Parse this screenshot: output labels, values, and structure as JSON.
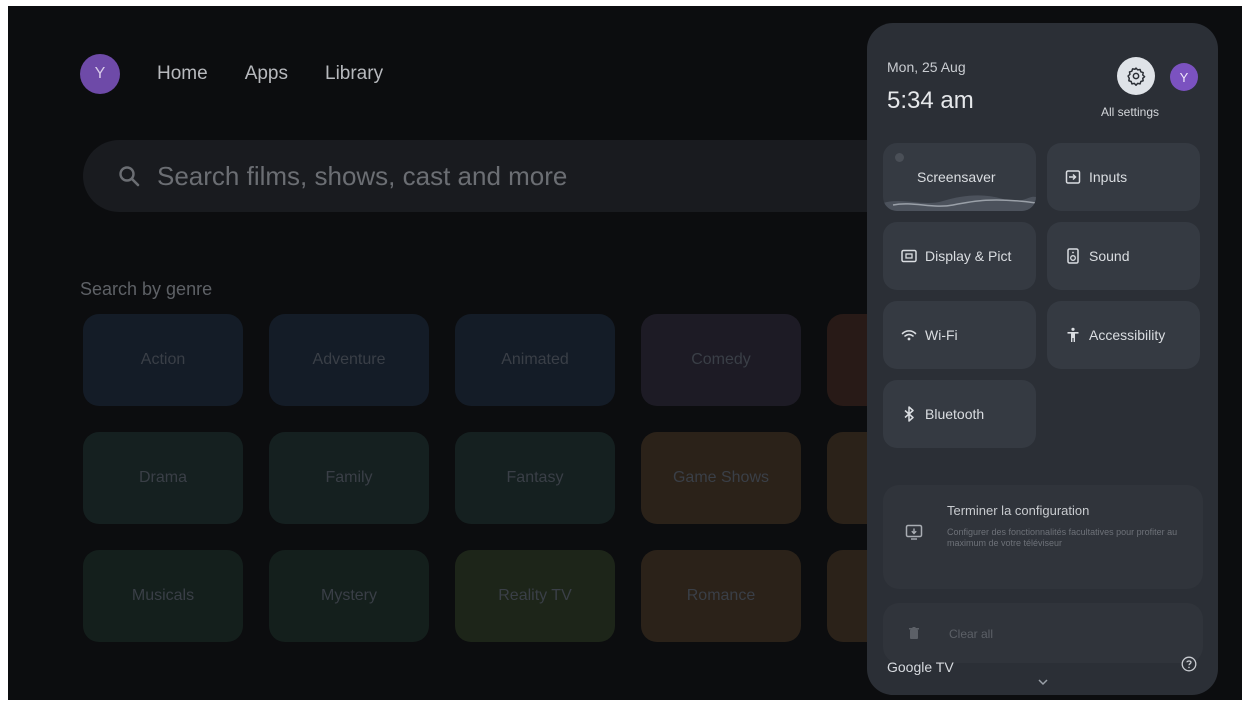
{
  "nav": {
    "avatar_letter": "Y",
    "items": [
      "Home",
      "Apps",
      "Library"
    ]
  },
  "search": {
    "placeholder": "Search films, shows, cast and more"
  },
  "genre": {
    "title": "Search by genre",
    "tiles": [
      {
        "label": "Action",
        "color": "#141c27"
      },
      {
        "label": "Adventure",
        "color": "#141c27"
      },
      {
        "label": "Animated",
        "color": "#141c27"
      },
      {
        "label": "Comedy",
        "color": "#1d1b25"
      },
      {
        "label": "",
        "color": "#281a17"
      },
      {
        "label": "Drama",
        "color": "#152020"
      },
      {
        "label": "Family",
        "color": "#152020"
      },
      {
        "label": "Fantasy",
        "color": "#152020"
      },
      {
        "label": "Game Shows",
        "color": "#2b2219"
      },
      {
        "label": "",
        "color": "#2b2219"
      },
      {
        "label": "Musicals",
        "color": "#141f1c"
      },
      {
        "label": "Mystery",
        "color": "#141f1c"
      },
      {
        "label": "Reality TV",
        "color": "#1d2519"
      },
      {
        "label": "Romance",
        "color": "#2b2219"
      },
      {
        "label": "",
        "color": "#2b2219"
      }
    ]
  },
  "panel": {
    "date": "Mon, 25 Aug",
    "time": "5:34 am",
    "avatar_letter": "Y",
    "all_settings": "All settings",
    "tiles": {
      "screensaver": "Screensaver",
      "inputs": "Inputs",
      "display": "Display & Pict",
      "sound": "Sound",
      "wifi": "Wi-Fi",
      "accessibility": "Accessibility",
      "bluetooth": "Bluetooth"
    },
    "notification": {
      "title": "Terminer la configuration",
      "body": "Configurer des fonctionnalités facultatives pour profiter au maximum de votre téléviseur"
    },
    "clear_all": "Clear all",
    "brand": "Google TV"
  },
  "icons": [
    "search-icon",
    "gear-icon",
    "inputs-icon",
    "display-icon",
    "speaker-icon",
    "wifi-icon",
    "accessibility-icon",
    "bluetooth-icon",
    "cast-icon",
    "trash-icon",
    "help-icon",
    "chevron-down-icon"
  ]
}
